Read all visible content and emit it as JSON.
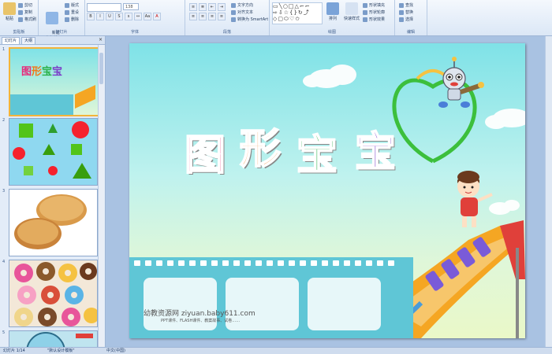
{
  "ribbon": {
    "clipboard": {
      "label": "剪贴板",
      "paste": "粘贴",
      "cut": "剪切",
      "copy": "复制",
      "format_painter": "格式刷"
    },
    "slides": {
      "label": "幻灯片",
      "new_slide": "新建\n幻灯片",
      "layout": "版式",
      "reset": "重设",
      "delete": "删除"
    },
    "font": {
      "label": "字体",
      "font_size": "138"
    },
    "paragraph": {
      "label": "段落",
      "text_direction": "文字方向",
      "align_text": "对齐文本",
      "convert_smartart": "转换为 SmartArt"
    },
    "drawing": {
      "label": "绘图",
      "arrange": "排列",
      "quick_styles": "快速样式",
      "shape_fill": "形状填充",
      "shape_outline": "形状轮廓",
      "shape_effects": "形状效果"
    },
    "editing": {
      "label": "编辑",
      "find": "查找",
      "replace": "替换",
      "select": "选择"
    }
  },
  "panel": {
    "tab_slides": "幻灯片",
    "tab_outline": "大纲",
    "close": "×",
    "slide_numbers": [
      "1",
      "2",
      "3",
      "4",
      "5"
    ]
  },
  "slide": {
    "title_chars": [
      "图",
      "形",
      "宝",
      "宝"
    ],
    "title_colors": [
      "#e8297a",
      "#f07a18",
      "#2bb14a",
      "#7a3cc8"
    ],
    "watermark": "幼教资源网 ziyuan.baby611.com",
    "watermark_sub": "PPT课件、FLASH课件、教案故事、试卷……"
  },
  "status": {
    "slide_info": "幻灯片 1/14",
    "theme": "\"默认设计模板\"",
    "language": "中文(中国)"
  }
}
